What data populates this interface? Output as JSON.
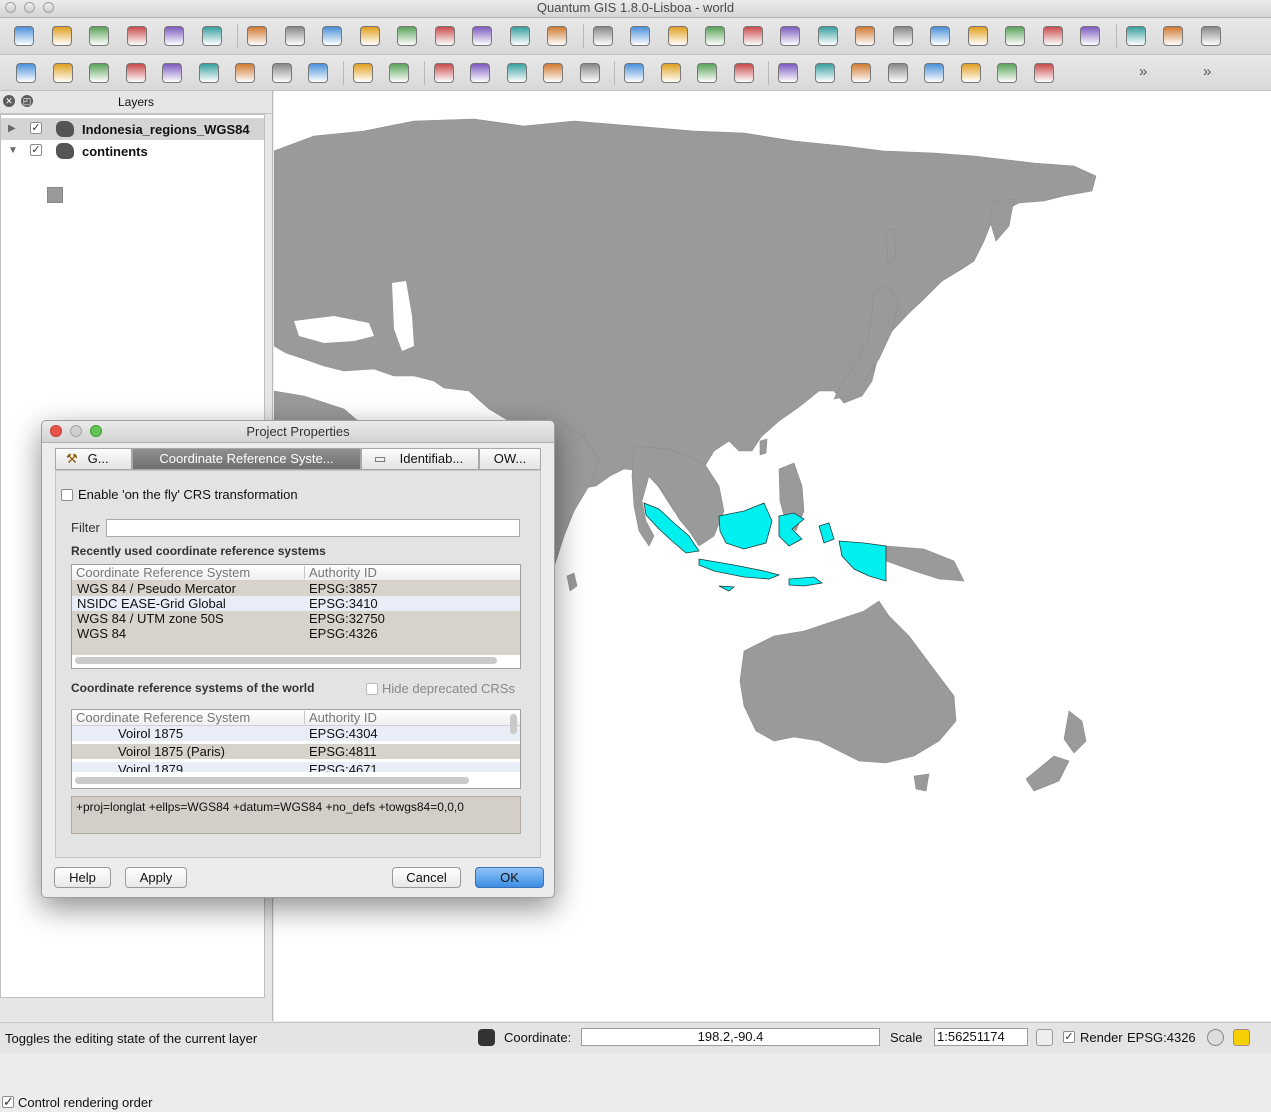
{
  "window": {
    "title": "Quantum GIS 1.8.0-Lisboa - world"
  },
  "toolbar1": {
    "icons": [
      "new-project-icon",
      "open-project-icon",
      "save-project-icon",
      "save-as-icon",
      "new-print-composer-icon",
      "print-icon",
      "toggle-editing-icon",
      "save-edits-icon",
      "add-feature-icon",
      "move-feature-icon",
      "node-tool-icon",
      "delete-selected-icon",
      "cut-features-icon",
      "copy-features-icon",
      "paste-features-icon",
      "xy-icon",
      "undo-icon",
      "redo-icon",
      "add-ring-icon",
      "add-part-icon",
      "simplify-icon",
      "delete-ring-icon",
      "delete-part-icon",
      "reshape-icon",
      "offset-curve-icon",
      "split-features-icon",
      "merge-features-icon",
      "merge-attributes-icon",
      "rotate-point-icon",
      "pan-icon",
      "pan-to-selection-icon",
      "zoom-in-icon"
    ]
  },
  "toolbar2": {
    "icons": [
      "add-vector-layer-icon",
      "add-raster-layer-icon",
      "add-postgis-icon",
      "add-spatialite-icon",
      "add-mssql-icon",
      "add-wms-icon",
      "add-wfs-icon",
      "new-shapefile-icon",
      "remove-layer-icon",
      "new-spatialite-icon",
      "gps-icon",
      "identify-icon",
      "settings-icon",
      "select-icon",
      "deselect-icon",
      "open-attribute-table-icon",
      "measure-icon",
      "map-tips-icon",
      "new-bookmark-icon",
      "show-bookmarks-icon",
      "text-annotation-icon",
      "label-icon",
      "pin-label-icon",
      "rotate-label-icon",
      "change-label-icon",
      "python-plugin-icon",
      "georeferencer-icon",
      "raster-icon"
    ],
    "overflow": "»"
  },
  "layers_panel": {
    "title": "Layers",
    "layers": [
      {
        "name": "Indonesia_regions_WGS84",
        "checked": true,
        "expanded": false
      },
      {
        "name": "continents",
        "checked": true,
        "expanded": true
      }
    ],
    "control_rendering_order": "Control rendering order"
  },
  "dialog": {
    "title": "Project Properties",
    "tabs": [
      {
        "label": "G..."
      },
      {
        "label": "Coordinate Reference Syste..."
      },
      {
        "label": "Identifiab..."
      },
      {
        "label": "OW..."
      }
    ],
    "enable_otf": "Enable 'on the fly' CRS transformation",
    "filter_label": "Filter",
    "filter_value": "",
    "recent_heading": "Recently used coordinate reference systems",
    "col_crs": "Coordinate Reference System",
    "col_auth": "Authority ID",
    "recent_rows": [
      {
        "name": "WGS 84 / Pseudo Mercator",
        "id": "EPSG:3857"
      },
      {
        "name": "NSIDC EASE-Grid Global",
        "id": "EPSG:3410"
      },
      {
        "name": "WGS 84 / UTM zone 50S",
        "id": "EPSG:32750"
      },
      {
        "name": "WGS 84",
        "id": "EPSG:4326"
      }
    ],
    "world_heading": "Coordinate reference systems of the world",
    "hide_deprecated": "Hide deprecated CRSs",
    "world_rows": [
      {
        "name": "Voirol 1875",
        "id": "EPSG:4304"
      },
      {
        "name": "Voirol 1875 (Paris)",
        "id": "EPSG:4811"
      },
      {
        "name": "Voirol 1879",
        "id": "EPSG:4671"
      }
    ],
    "proj_string": "+proj=longlat +ellps=WGS84 +datum=WGS84 +no_defs +towgs84=0,0,0",
    "buttons": {
      "help": "Help",
      "apply": "Apply",
      "cancel": "Cancel",
      "ok": "OK"
    }
  },
  "statusbar": {
    "message": "Toggles the editing state of the current layer",
    "coordinate_label": "Coordinate:",
    "coordinate_value": "198.2,-90.4",
    "scale_label": "Scale",
    "scale_value": "1:56251174",
    "render_label": "Render",
    "crs": "EPSG:4326"
  },
  "colors": {
    "land": "#9a9a9a",
    "highlight": "#00f0f0",
    "ok_button": "#3d8ee6"
  }
}
